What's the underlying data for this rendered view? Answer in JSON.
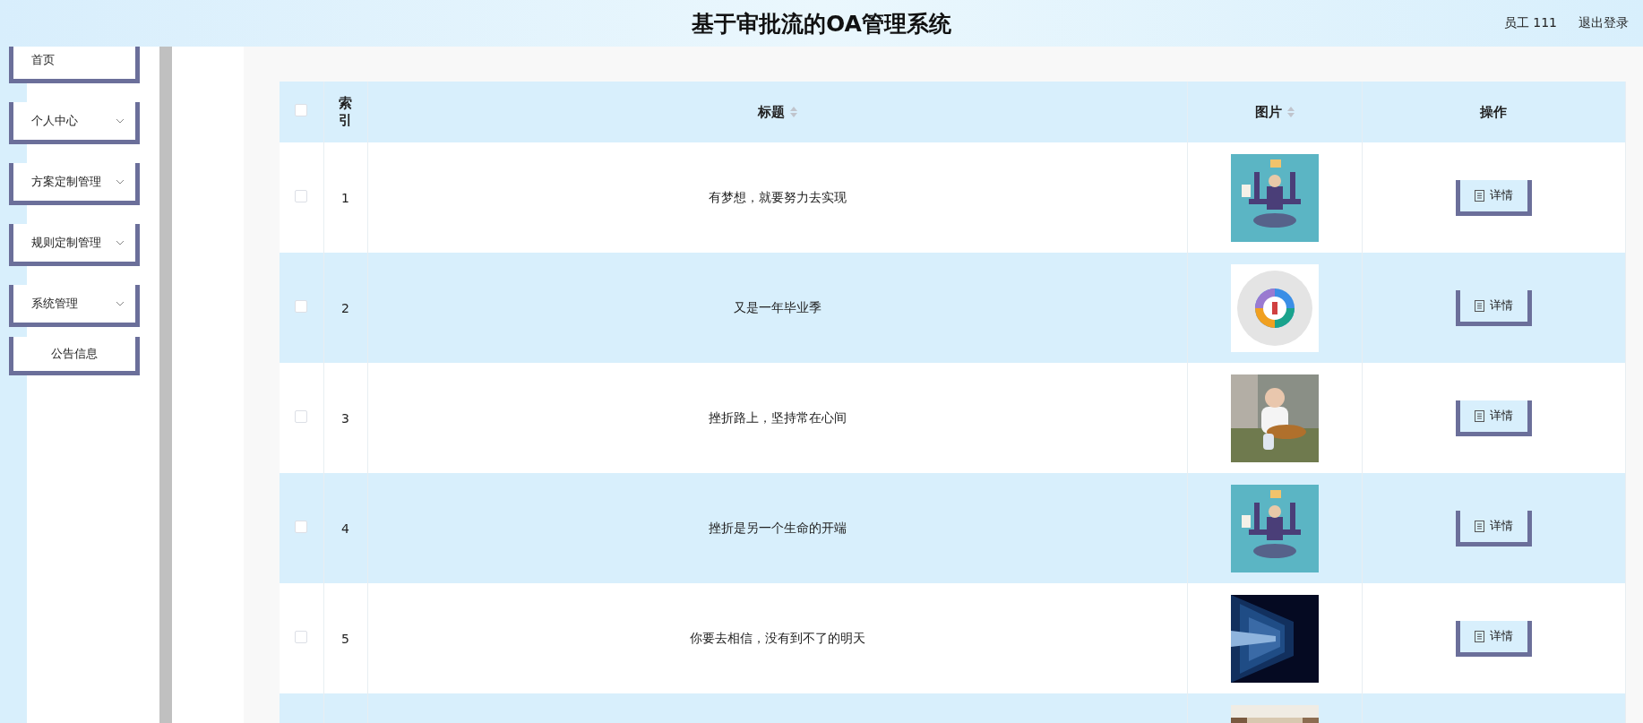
{
  "header": {
    "title": "基于审批流的OA管理系统",
    "user": "员工 111",
    "logout": "退出登录"
  },
  "sidebar": {
    "items": [
      {
        "label": "首页",
        "kind": "link"
      },
      {
        "label": "个人中心",
        "kind": "menu"
      },
      {
        "label": "方案定制管理",
        "kind": "menu"
      },
      {
        "label": "规则定制管理",
        "kind": "menu"
      },
      {
        "label": "系统管理",
        "kind": "menu"
      },
      {
        "label": "公告信息",
        "kind": "sub"
      }
    ]
  },
  "table": {
    "all_checked": false,
    "columns": [
      {
        "label": "索引",
        "sortable": false
      },
      {
        "label": "标题",
        "sortable": true
      },
      {
        "label": "图片",
        "sortable": true
      },
      {
        "label": "操作",
        "sortable": false
      }
    ],
    "rows": [
      {
        "checked": false,
        "index": "1",
        "title": "有梦想，就要努力去实现",
        "picture": {
          "kind": "picture"
        },
        "action": "详情"
      },
      {
        "checked": false,
        "index": "2",
        "title": "又是一年毕业季",
        "picture": {
          "kind": "picture"
        },
        "action": "详情"
      },
      {
        "checked": false,
        "index": "3",
        "title": "挫折路上，坚持常在心间",
        "picture": {
          "kind": "picture"
        },
        "action": "详情"
      },
      {
        "checked": false,
        "index": "4",
        "title": "挫折是另一个生命的开端",
        "picture": {
          "kind": "picture"
        },
        "action": "详情"
      },
      {
        "checked": false,
        "index": "5",
        "title": "你要去相信，没有到不了的明天",
        "picture": {
          "kind": "picture"
        },
        "action": "详情"
      },
      {
        "picture": {
          "kind": "picture"
        }
      }
    ]
  }
}
